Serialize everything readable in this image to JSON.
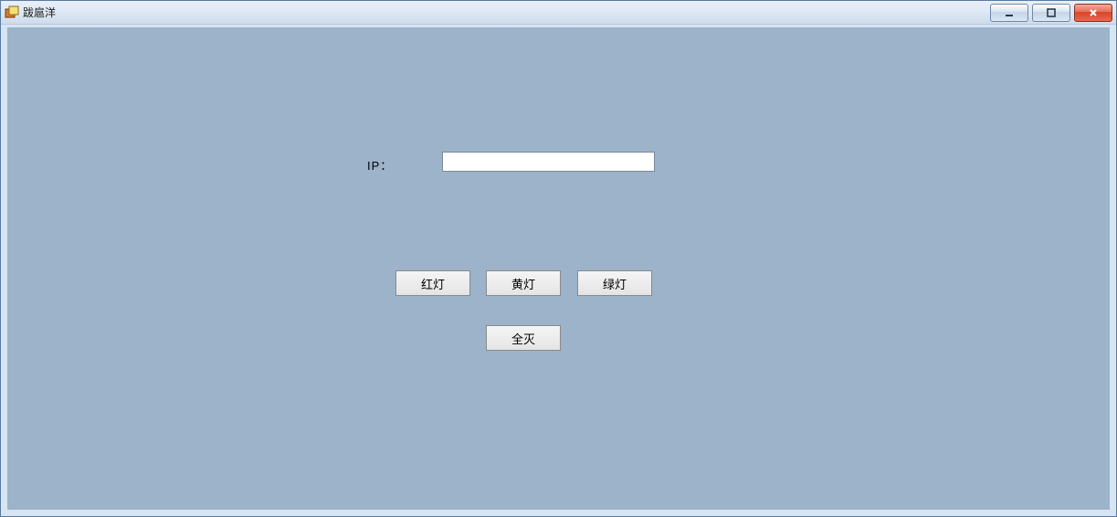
{
  "window": {
    "title": "跋扈洋"
  },
  "form": {
    "ip_label": "IP：",
    "ip_value": ""
  },
  "buttons": {
    "red": "红灯",
    "yellow": "黄灯",
    "green": "绿灯",
    "alloff": "全灭"
  }
}
